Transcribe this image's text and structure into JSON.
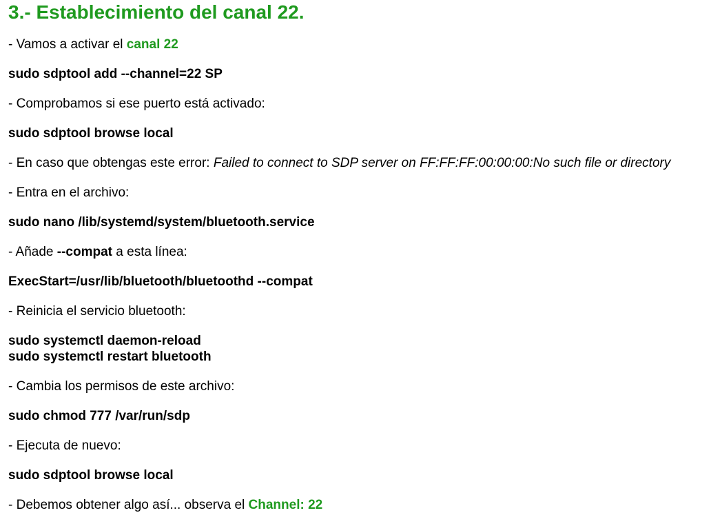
{
  "section": {
    "title": "3.- Establecimiento del canal 22."
  },
  "steps": {
    "s1_text": "- Vamos a activar el ",
    "s1_highlight": "canal 22",
    "cmd1": "sudo sdptool add --channel=22 SP",
    "s2_text": "- Comprobamos si ese puerto está activado:",
    "cmd2": "sudo sdptool browse local",
    "s3_text": "- En caso que obtengas este error: ",
    "s3_error": "Failed to connect to SDP server on FF:FF:FF:00:00:00:No such file or directory",
    "s4_text": "- Entra en el archivo:",
    "cmd3": "sudo nano /lib/systemd/system/bluetooth.service",
    "s5_prefix": "- Añade ",
    "s5_bold": "--compat",
    "s5_suffix": " a esta línea:",
    "cmd4": "ExecStart=/usr/lib/bluetooth/bluetoothd --compat",
    "s6_text": "- Reinicia el servicio bluetooth:",
    "cmd5a": "sudo systemctl daemon-reload",
    "cmd5b": "sudo systemctl restart bluetooth",
    "s7_text": "- Cambia los permisos de este archivo:",
    "cmd6": "sudo chmod 777 /var/run/sdp",
    "s8_text": "- Ejecuta de nuevo:",
    "cmd7": "sudo sdptool browse local",
    "s9_text": "- Debemos obtener algo así... observa el ",
    "s9_highlight": "Channel: 22"
  },
  "colors": {
    "accent_green": "#1f9a1f",
    "text": "#000000",
    "background": "#ffffff"
  }
}
